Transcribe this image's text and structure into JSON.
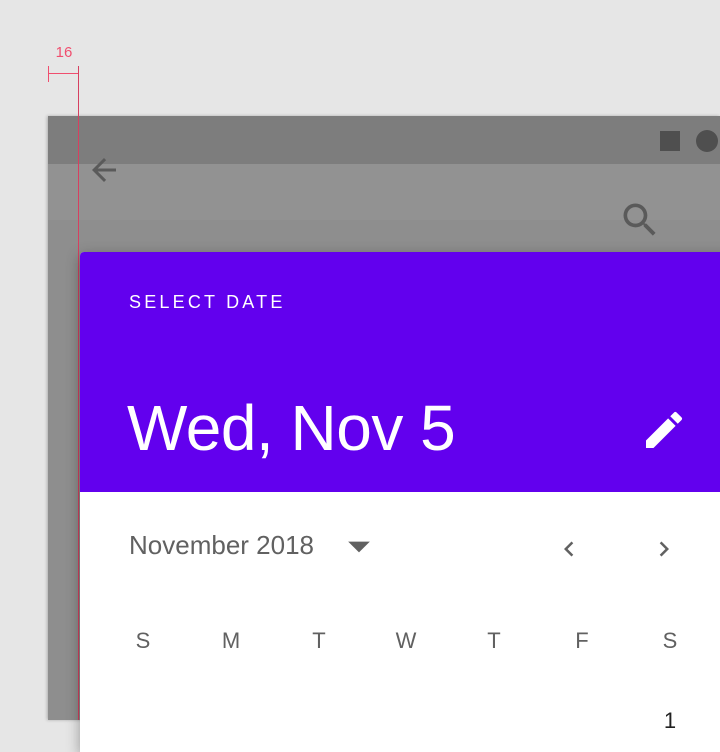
{
  "annotation": {
    "spacing_label": "16"
  },
  "statusbar": {
    "icons": [
      "square-icon",
      "circle-icon"
    ]
  },
  "appbar": {
    "icons": [
      "back-arrow-icon",
      "search-icon"
    ]
  },
  "dialog": {
    "header": {
      "title": "SELECT DATE",
      "selected_date": "Wed, Nov 5",
      "edit_icon": "pencil-icon",
      "color": "#6200ee"
    },
    "month": {
      "label": "November 2018",
      "dropdown_icon": "caret-down-icon",
      "prev_icon": "chevron-left-icon",
      "next_icon": "chevron-right-icon"
    },
    "weekdays": [
      "S",
      "M",
      "T",
      "W",
      "T",
      "F",
      "S"
    ],
    "first_day": "1"
  }
}
